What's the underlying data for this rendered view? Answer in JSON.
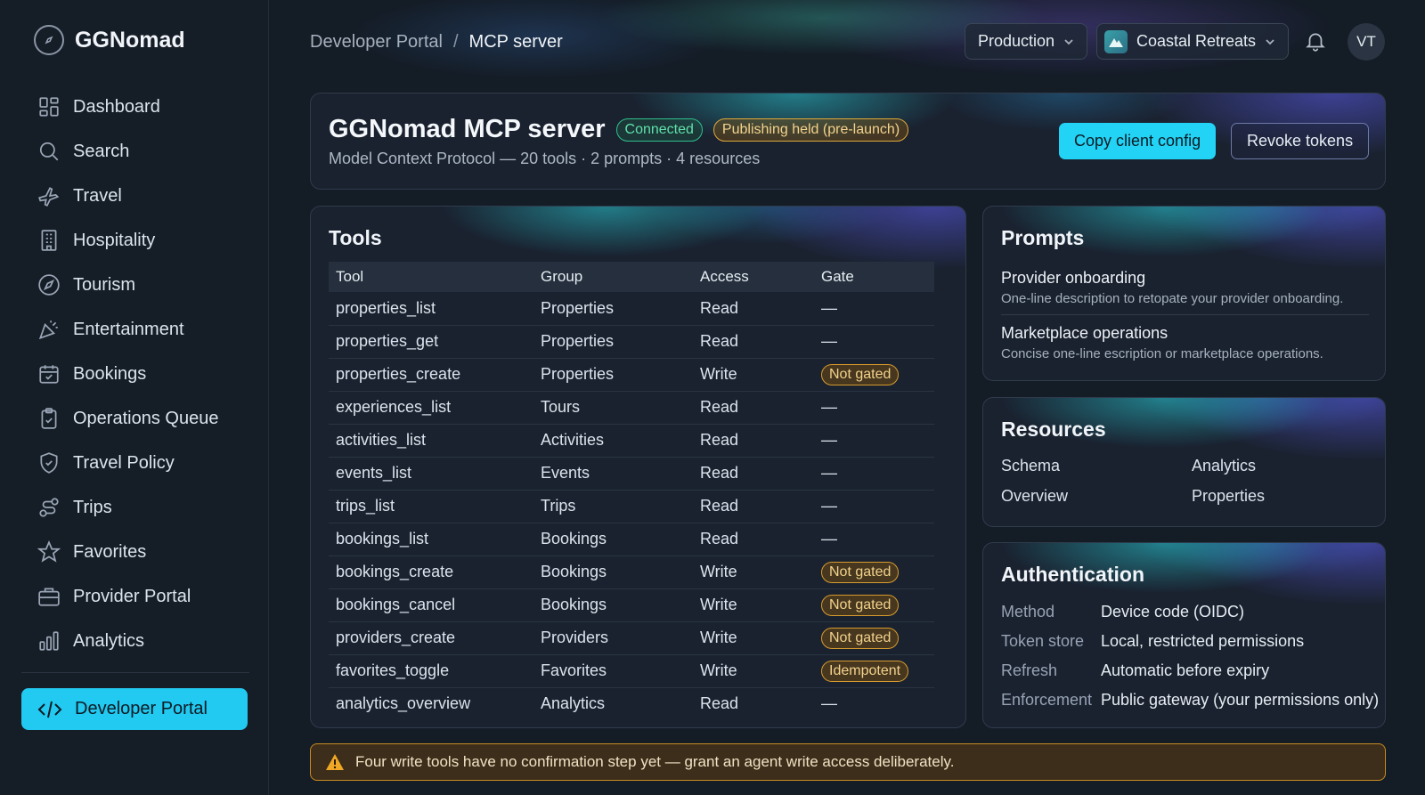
{
  "app": {
    "name": "GGNomad"
  },
  "sidebar": {
    "items": [
      {
        "label": "Dashboard",
        "icon": "dashboard-icon"
      },
      {
        "label": "Search",
        "icon": "search-icon"
      },
      {
        "label": "Travel",
        "icon": "plane-icon"
      },
      {
        "label": "Hospitality",
        "icon": "building-icon"
      },
      {
        "label": "Tourism",
        "icon": "compass-icon"
      },
      {
        "label": "Entertainment",
        "icon": "party-icon"
      },
      {
        "label": "Bookings",
        "icon": "calendar-icon"
      },
      {
        "label": "Operations Queue",
        "icon": "clipboard-icon"
      },
      {
        "label": "Travel Policy",
        "icon": "shield-icon"
      },
      {
        "label": "Trips",
        "icon": "route-icon"
      },
      {
        "label": "Favorites",
        "icon": "star-icon"
      },
      {
        "label": "Provider Portal",
        "icon": "briefcase-icon"
      },
      {
        "label": "Analytics",
        "icon": "bar-chart-icon"
      }
    ],
    "active": {
      "label": "Developer Portal",
      "icon": "code-icon"
    }
  },
  "topbar": {
    "breadcrumb": [
      "Developer Portal",
      "MCP server"
    ],
    "environment": "Production",
    "organization": "Coastal Retreats",
    "avatar_initials": "VT"
  },
  "header": {
    "title": "GGNomad MCP server",
    "status_badge": "Connected",
    "publish_badge": "Publishing held (pre-launch)",
    "subtitle": "Model Context Protocol — 20 tools · 2 prompts · 4 resources",
    "copy_button": "Copy client config",
    "revoke_button": "Revoke tokens"
  },
  "tools": {
    "title": "Tools",
    "columns": [
      "Tool",
      "Group",
      "Access",
      "Gate"
    ],
    "rows": [
      {
        "tool": "properties_list",
        "group": "Properties",
        "access": "Read",
        "gate": "—"
      },
      {
        "tool": "properties_get",
        "group": "Properties",
        "access": "Read",
        "gate": "—"
      },
      {
        "tool": "properties_create",
        "group": "Properties",
        "access": "Write",
        "gate": "Not gated"
      },
      {
        "tool": "experiences_list",
        "group": "Tours",
        "access": "Read",
        "gate": "—"
      },
      {
        "tool": "activities_list",
        "group": "Activities",
        "access": "Read",
        "gate": "—"
      },
      {
        "tool": "events_list",
        "group": "Events",
        "access": "Read",
        "gate": "—"
      },
      {
        "tool": "trips_list",
        "group": "Trips",
        "access": "Read",
        "gate": "—"
      },
      {
        "tool": "bookings_list",
        "group": "Bookings",
        "access": "Read",
        "gate": "—"
      },
      {
        "tool": "bookings_create",
        "group": "Bookings",
        "access": "Write",
        "gate": "Not gated"
      },
      {
        "tool": "bookings_cancel",
        "group": "Bookings",
        "access": "Write",
        "gate": "Not gated"
      },
      {
        "tool": "providers_create",
        "group": "Providers",
        "access": "Write",
        "gate": "Not gated"
      },
      {
        "tool": "favorites_toggle",
        "group": "Favorites",
        "access": "Write",
        "gate": "Idempotent"
      },
      {
        "tool": "analytics_overview",
        "group": "Analytics",
        "access": "Read",
        "gate": "—"
      }
    ]
  },
  "prompts": {
    "title": "Prompts",
    "items": [
      {
        "name": "Provider onboarding",
        "description": "One-line description to retopate your provider onboarding."
      },
      {
        "name": "Marketplace operations",
        "description": "Concise one-line escription or marketplace operations."
      }
    ]
  },
  "resources": {
    "title": "Resources",
    "items": [
      "Schema",
      "Analytics",
      "Overview",
      "Properties"
    ]
  },
  "authentication": {
    "title": "Authentication",
    "rows": [
      {
        "key": "Method",
        "value": "Device code (OIDC)"
      },
      {
        "key": "Token store",
        "value": "Local, restricted permissions"
      },
      {
        "key": "Refresh",
        "value": "Automatic before expiry"
      },
      {
        "key": "Enforcement",
        "value": "Public gateway (your permissions only)"
      }
    ]
  },
  "warning": {
    "text": "Four write tools have no confirmation step yet — grant an agent write access deliberately."
  },
  "colors": {
    "accent": "#22d3f5",
    "connected": "#5fe0aa",
    "amber": "#f3d28c",
    "background": "#141c26"
  }
}
